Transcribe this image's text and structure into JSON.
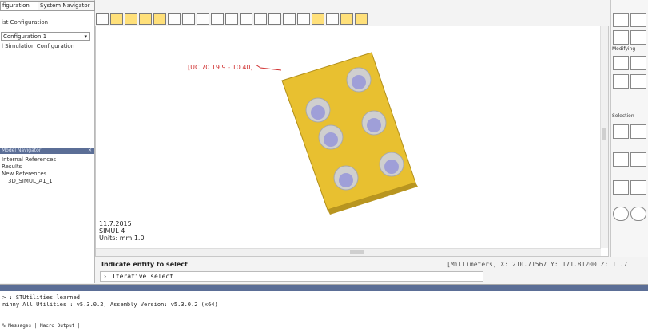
{
  "left_panel": {
    "tabs": [
      "figuration",
      "System Navigator"
    ],
    "configuration_label": "ist Configuration",
    "configuration_select": "Configuration 1",
    "configuration_item": "l Simulation Configuration",
    "navigator_header": "Model Navigator",
    "navigator_items": [
      "Internal References",
      "Results",
      "New References",
      "3D_SIMUL_A1_1"
    ]
  },
  "viewport": {
    "annotation": "[UC.70 19.9 - 10.40]",
    "info_lines": [
      "11.7.2015",
      "SIMUL 4",
      "Units: mm 1.0"
    ]
  },
  "right_palette": {
    "sections": [
      "Modifying",
      "Selection"
    ]
  },
  "command": {
    "prompt": "Indicate entity to select",
    "status": "[Millimeters] X: 210.71567 Y: 171.81200 Z: 11.7",
    "input_value": "Iterative select"
  },
  "output": {
    "lines": [
      "> : STUtilities learned",
      "ninny All Utilities : v5.3.0.2, Assembly Version: v5.3.0.2 (x64)",
      "",
      "% Messages | Macro Output |"
    ]
  }
}
